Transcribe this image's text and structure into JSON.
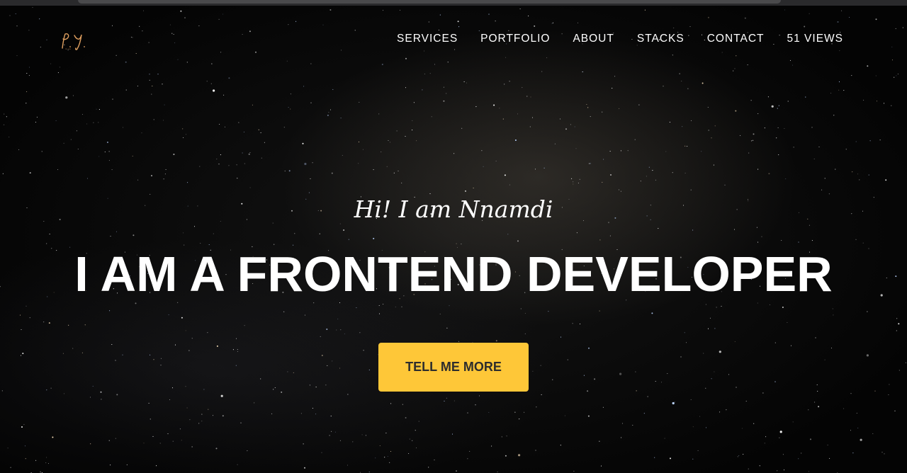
{
  "logo": {
    "text": "P.Y."
  },
  "nav": {
    "items": [
      {
        "label": "SERVICES"
      },
      {
        "label": "PORTFOLIO"
      },
      {
        "label": "ABOUT"
      },
      {
        "label": "STACKS"
      },
      {
        "label": "CONTACT"
      },
      {
        "label": "51 VIEWS"
      }
    ]
  },
  "hero": {
    "intro": "Hi! I am Nnamdi",
    "heading": "I AM A FRONTEND DEVELOPER",
    "cta_label": "TELL ME MORE"
  },
  "colors": {
    "background": "#050505",
    "accent": "#fec738",
    "text": "#ffffff",
    "logo": "#e0a060"
  }
}
